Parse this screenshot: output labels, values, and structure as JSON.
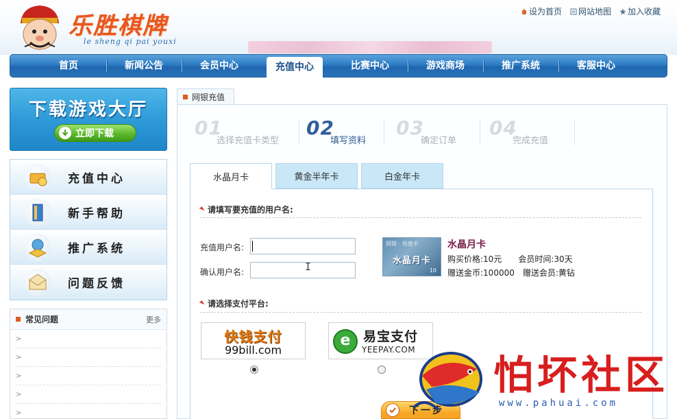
{
  "header": {
    "logo_text": "乐胜棋牌",
    "logo_sub": "le sheng qi pai youxi",
    "links": [
      {
        "label": "设为首页",
        "icon": "home-icon"
      },
      {
        "label": "网站地图",
        "icon": "map-icon"
      },
      {
        "label": "加入收藏",
        "icon": "star-icon"
      }
    ]
  },
  "nav": {
    "items": [
      "首页",
      "新闻公告",
      "会员中心",
      "充值中心",
      "比赛中心",
      "游戏商场",
      "推广系统",
      "客服中心"
    ],
    "active": "充值中心"
  },
  "sidebar": {
    "download_title": "下载游戏大厅",
    "download_button": "立即下载",
    "menu": [
      {
        "label": "充值中心",
        "icon": "coins-icon"
      },
      {
        "label": "新手帮助",
        "icon": "book-icon"
      },
      {
        "label": "推广系统",
        "icon": "globe-icon"
      },
      {
        "label": "问题反馈",
        "icon": "envelope-icon"
      }
    ],
    "faq": {
      "title": "常见问题",
      "more": "更多",
      "items": [
        ">",
        ">",
        ">",
        ">",
        ">"
      ]
    }
  },
  "main": {
    "panel_tab": "网银充值",
    "steps": [
      {
        "num": "01",
        "label": "选择充值卡类型"
      },
      {
        "num": "02",
        "label": "填写资料"
      },
      {
        "num": "03",
        "label": "确定订单"
      },
      {
        "num": "04",
        "label": "完成充值"
      }
    ],
    "active_step": "02",
    "card_tabs": [
      "水晶月卡",
      "黄金半年卡",
      "白金年卡"
    ],
    "active_card_tab": "水晶月卡",
    "username_section": "请填写要充值的用户名:",
    "fields": {
      "username_label": "充值用户名:",
      "username_value": "",
      "confirm_label": "确认用户名:",
      "confirm_value": ""
    },
    "card": {
      "image_top": "网银 · 充值卡",
      "image_text": "水晶月卡",
      "image_num": "10",
      "name": "水晶月卡",
      "line1": "购买价格:10元　　会员时间:30天",
      "line2": "赠送金币:100000　赠送会员:黄钻"
    },
    "payment_section": "请选择支付平台:",
    "payments": [
      {
        "top": "快钱支付",
        "bottom": "99bill.com",
        "selected": true
      },
      {
        "top": "易宝支付",
        "bottom": "YEEPAY.COM",
        "selected": false
      }
    ],
    "next_button": "下一步"
  },
  "watermark": {
    "text": "怕坏社区",
    "url": "www.pahuai.com"
  },
  "colors": {
    "nav_blue": "#2d7cc4",
    "accent_orange": "#e05a20",
    "step_active": "#2f5f9a",
    "card_tab_bg": "#c9e7f7",
    "watermark_red": "#d81e1e"
  }
}
